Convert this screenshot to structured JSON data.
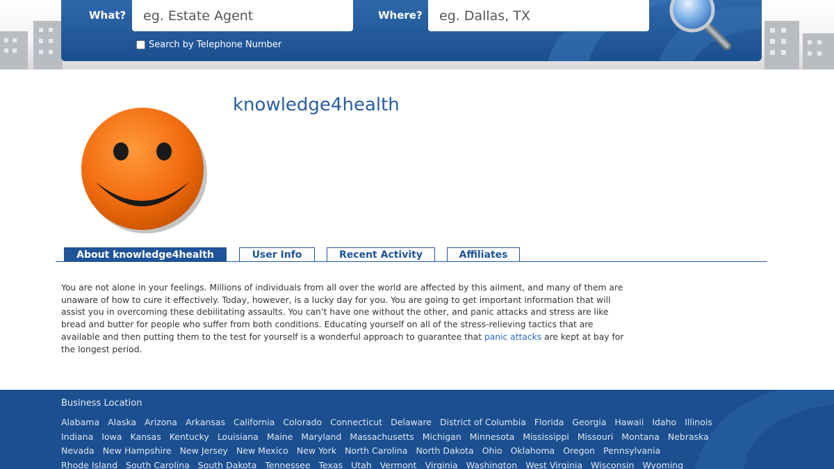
{
  "search": {
    "what_label": "What?",
    "what_placeholder": "eg. Estate Agent",
    "where_label": "Where?",
    "where_placeholder": "eg. Dallas, TX",
    "phone_checkbox_label": "Search by Telephone Number",
    "search_button_icon": "magnifier-icon"
  },
  "profile": {
    "name": "knowledge4health",
    "avatar_icon": "smiley-face-icon"
  },
  "tabs": [
    {
      "label": "About knowledge4health",
      "active": true
    },
    {
      "label": "User Info",
      "active": false
    },
    {
      "label": "Recent Activity",
      "active": false
    },
    {
      "label": "Affiliates",
      "active": false
    }
  ],
  "about": {
    "text_before_link": "You are not alone in your feelings. Millions of individuals from all over the world are affected by this ailment, and many of them are unaware of how to cure it effectively. Today, however, is a lucky day for you. You are going to get important information that will assist you in overcoming these debilitating assaults. You can’t have one without the other, and panic attacks and stress are like bread and butter for people who suffer from both conditions. Educating yourself on all of the stress-relieving tactics that are available and then putting them to the test for yourself is a wonderful approach to guarantee that ",
    "link_text": "panic attacks",
    "text_after_link": " are kept at bay for the longest period."
  },
  "footer": {
    "title": "Business Location",
    "state_rows": [
      [
        "Alabama",
        "Alaska",
        "Arizona",
        "Arkansas",
        "California",
        "Colorado",
        "Connecticut",
        "Delaware",
        "District of Columbia",
        "Florida",
        "Georgia",
        "Hawaii",
        "Idaho",
        "Illinois"
      ],
      [
        "Indiana",
        "Iowa",
        "Kansas",
        "Kentucky",
        "Louisiana",
        "Maine",
        "Maryland",
        "Massachusetts",
        "Michigan",
        "Minnesota",
        "Mississippi",
        "Missouri",
        "Montana",
        "Nebraska"
      ],
      [
        "Nevada",
        "New Hampshire",
        "New Jersey",
        "New Mexico",
        "New York",
        "North Carolina",
        "North Dakota",
        "Ohio",
        "Oklahoma",
        "Oregon",
        "Pennsylvania"
      ],
      [
        "Rhode Island",
        "South Carolina",
        "South Dakota",
        "Tennessee",
        "Texas",
        "Utah",
        "Vermont",
        "Virginia",
        "Washington",
        "West Virginia",
        "Wisconsin",
        "Wyoming"
      ]
    ]
  },
  "colors": {
    "brand_blue": "#1f5499",
    "link_blue": "#2a6bbf",
    "avatar_orange": "#f26d10"
  }
}
